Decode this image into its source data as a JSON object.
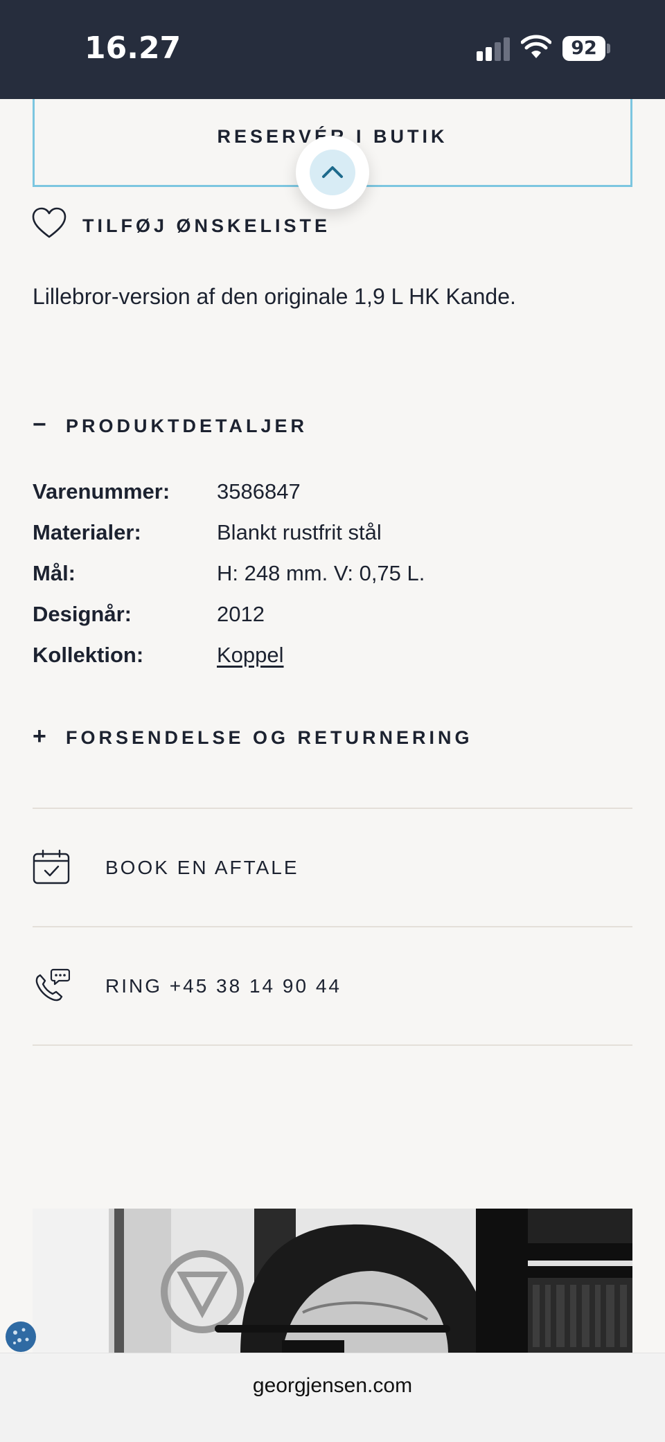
{
  "status_bar": {
    "time": "16.27",
    "battery": "92"
  },
  "actions": {
    "reserve_label": "RESERVÉR I BUTIK",
    "wishlist_label": "TILFØJ ØNSKELISTE"
  },
  "description": "Lillebror-version af den originale 1,9 L HK Kande.",
  "product_details": {
    "header_sign": "−",
    "header": "PRODUKTDETALJER",
    "rows": [
      {
        "key": "Varenummer:",
        "value": "3586847"
      },
      {
        "key": "Materialer:",
        "value": "Blankt rustfrit stål"
      },
      {
        "key": "Mål:",
        "value": "H: 248 mm. V: 0,75 L."
      },
      {
        "key": "Designår:",
        "value": "2012"
      },
      {
        "key": "Kollektion:",
        "value": "Koppel"
      }
    ]
  },
  "shipping": {
    "header_sign": "+",
    "header": "FORSENDELSE OG RETURNERING"
  },
  "contact": {
    "book_label": "BOOK EN AFTALE",
    "call_label": "RING +45 38 14 90 44"
  },
  "browser": {
    "url": "georgjensen.com"
  },
  "icons": {
    "scroll_top": "chevron-up-icon",
    "wishlist": "heart-icon",
    "book": "calendar-check-icon",
    "call": "phone-chat-icon",
    "cookie": "cookie-icon"
  },
  "colors": {
    "accent": "#7cc6e0",
    "status_bar": "#262d3d",
    "text": "#1c2230"
  }
}
